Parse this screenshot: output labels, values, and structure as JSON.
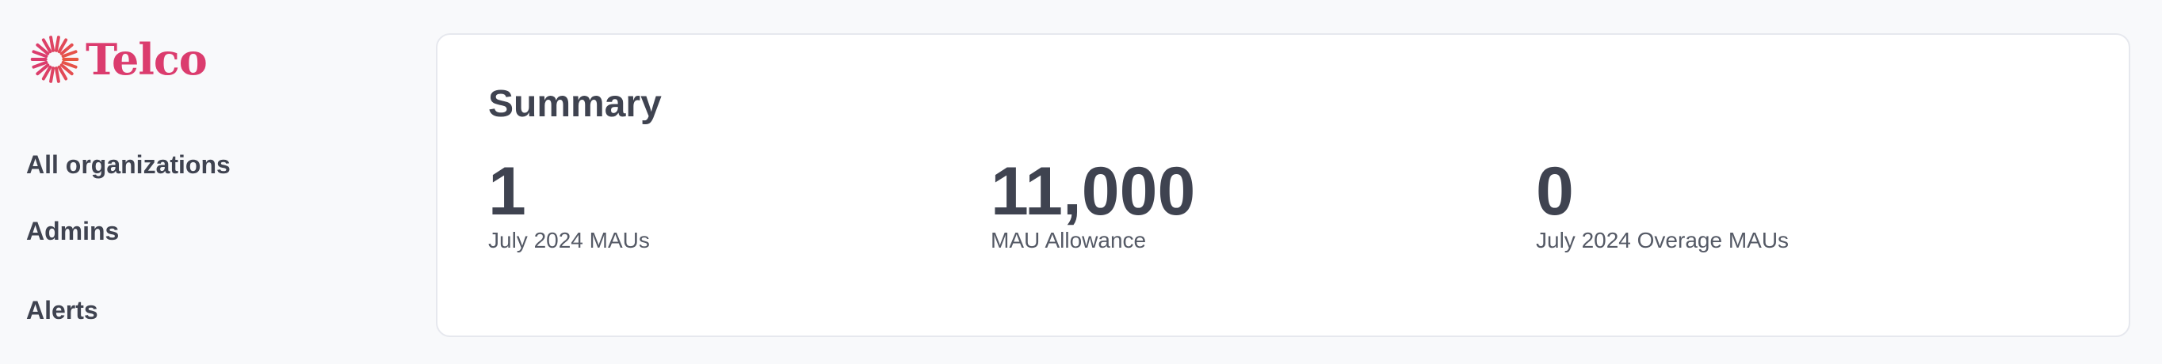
{
  "brand": {
    "name": "Telco",
    "color": "#db3c6e",
    "icon": "sunburst-logo-icon"
  },
  "sidebar": {
    "items": [
      {
        "label": "All organizations"
      },
      {
        "label": "Admins"
      },
      {
        "label": "Alerts"
      }
    ]
  },
  "summary": {
    "title": "Summary",
    "stats": [
      {
        "value": "1",
        "label": "July 2024 MAUs"
      },
      {
        "value": "11,000",
        "label": "MAU Allowance"
      },
      {
        "value": "0",
        "label": "July 2024 Overage MAUs"
      }
    ]
  }
}
